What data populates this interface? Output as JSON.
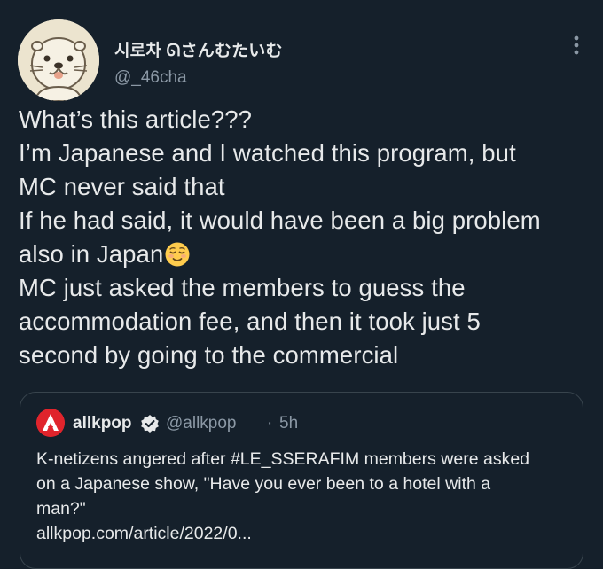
{
  "tweet": {
    "author": {
      "name": "시로차 ᘏさんむたいむ",
      "handle": "@_46cha"
    },
    "body_lines": [
      "What’s this article???",
      "I’m Japanese and I watched this program, but",
      "MC never said that",
      "If he had said, it would have been a big problem",
      "also in Japan",
      "MC just asked the members to guess the",
      "accommodation fee, and then it took just 5",
      "second by going to the commercial"
    ],
    "emoji": "relieved-face"
  },
  "quoted": {
    "name": "allkpop",
    "handle": "@allkpop",
    "separator": "·",
    "time": "5h",
    "text_lines": [
      "K-netizens angered after #LE_SSERAFIM members were asked",
      "on a Japanese show, \"Have you ever been to a hotel with a",
      "man?\"",
      "allkpop.com/article/2022/0..."
    ]
  },
  "colors": {
    "background": "#15202b",
    "text": "#e7e9ea",
    "secondary": "#8b98a5",
    "border": "#38444d",
    "brand_red": "#e0242c",
    "verified_blue": "#1d9bf0"
  },
  "icons": [
    "avatar-otter-illustration",
    "more-vertical-icon",
    "relieved-face-emoji",
    "allkpop-logo-icon",
    "verified-badge-icon"
  ]
}
